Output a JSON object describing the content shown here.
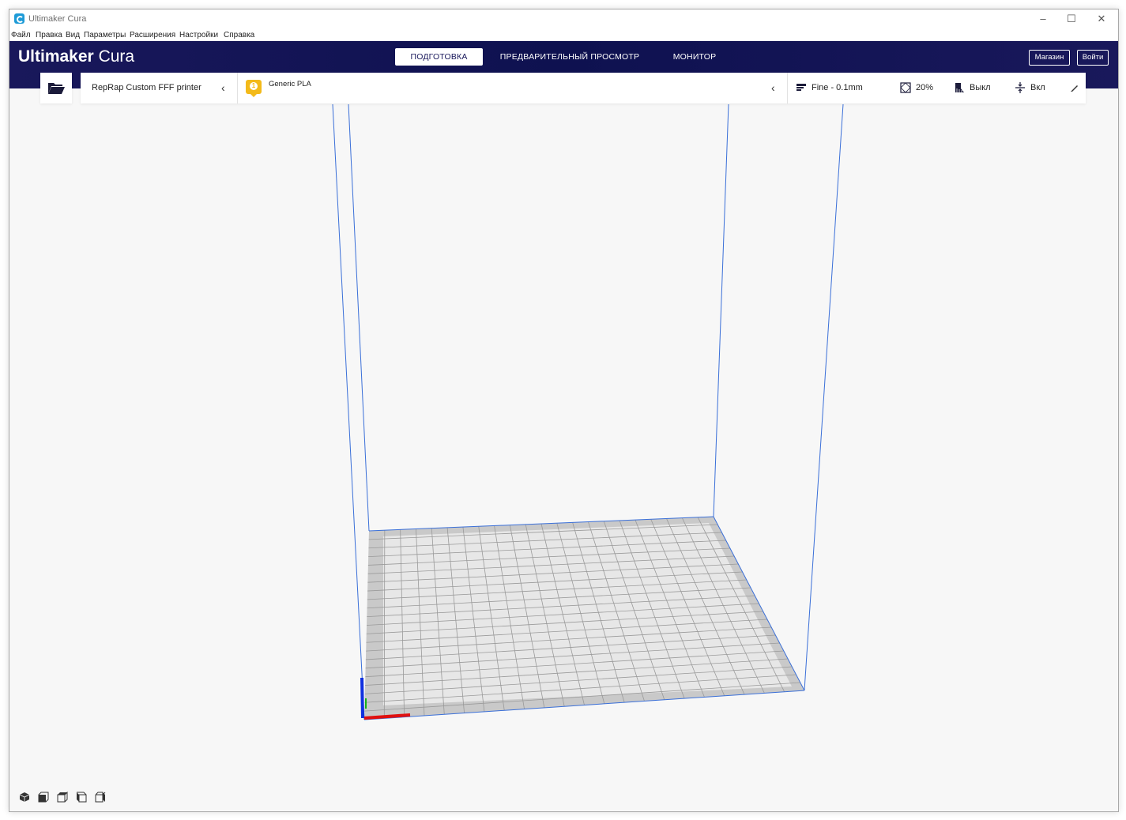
{
  "window": {
    "title": "Ultimaker Cura",
    "minimize": "–",
    "maximize": "☐",
    "close": "✕"
  },
  "menu": [
    "Файл",
    "Правка",
    "Вид",
    "Параметры",
    "Расширения",
    "Настройки",
    "Справка"
  ],
  "header": {
    "logo_bold": "Ultimaker",
    "logo_light": "Cura",
    "tabs": [
      {
        "label": "ПОДГОТОВКА",
        "active": true
      },
      {
        "label": "ПРЕДВАРИТЕЛЬНЫЙ ПРОСМОТР",
        "active": false
      },
      {
        "label": "МОНИТОР",
        "active": false
      }
    ],
    "marketplace": "Магазин",
    "signin": "Войти"
  },
  "toolbar": {
    "printer": "RepRap Custom FFF printer",
    "material": "Generic PLA",
    "material_badge": "1",
    "profile": "Fine - 0.1mm",
    "infill": "20%",
    "support": "Выкл",
    "adhesion": "Вкл"
  },
  "colors": {
    "header": "#19185b",
    "badge": "#f3ba1a",
    "volume_edge": "#3a6fd8",
    "axis_x": "#e01010",
    "axis_y": "#18b018",
    "axis_z": "#1030e0"
  },
  "icons": [
    "folder-open-icon",
    "chevron-left-icon",
    "layers-icon",
    "infill-icon",
    "support-icon",
    "adhesion-icon",
    "pencil-icon",
    "view-3d-icon",
    "view-front-icon",
    "view-top-icon",
    "view-left-icon",
    "view-right-icon"
  ]
}
